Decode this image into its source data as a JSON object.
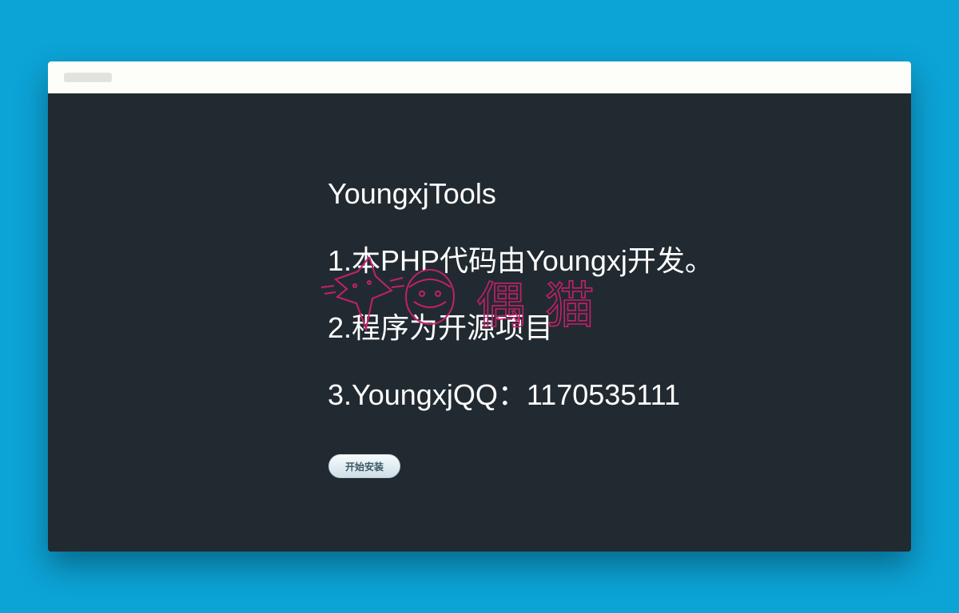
{
  "lines": [
    "YoungxjTools",
    "1.本PHP代码由Youngxj开发。",
    "2.程序为开源项目",
    "3.YoungxjQQ：1170535111"
  ],
  "install_button": {
    "label": "开始安装"
  },
  "watermark": {
    "chars": [
      "偶",
      "猫"
    ]
  },
  "colors": {
    "background": "#0ca3d6",
    "panel": "#222a31",
    "titlebar": "#fdfdf9",
    "text": "#ffffff",
    "watermark": "#c4206a"
  }
}
